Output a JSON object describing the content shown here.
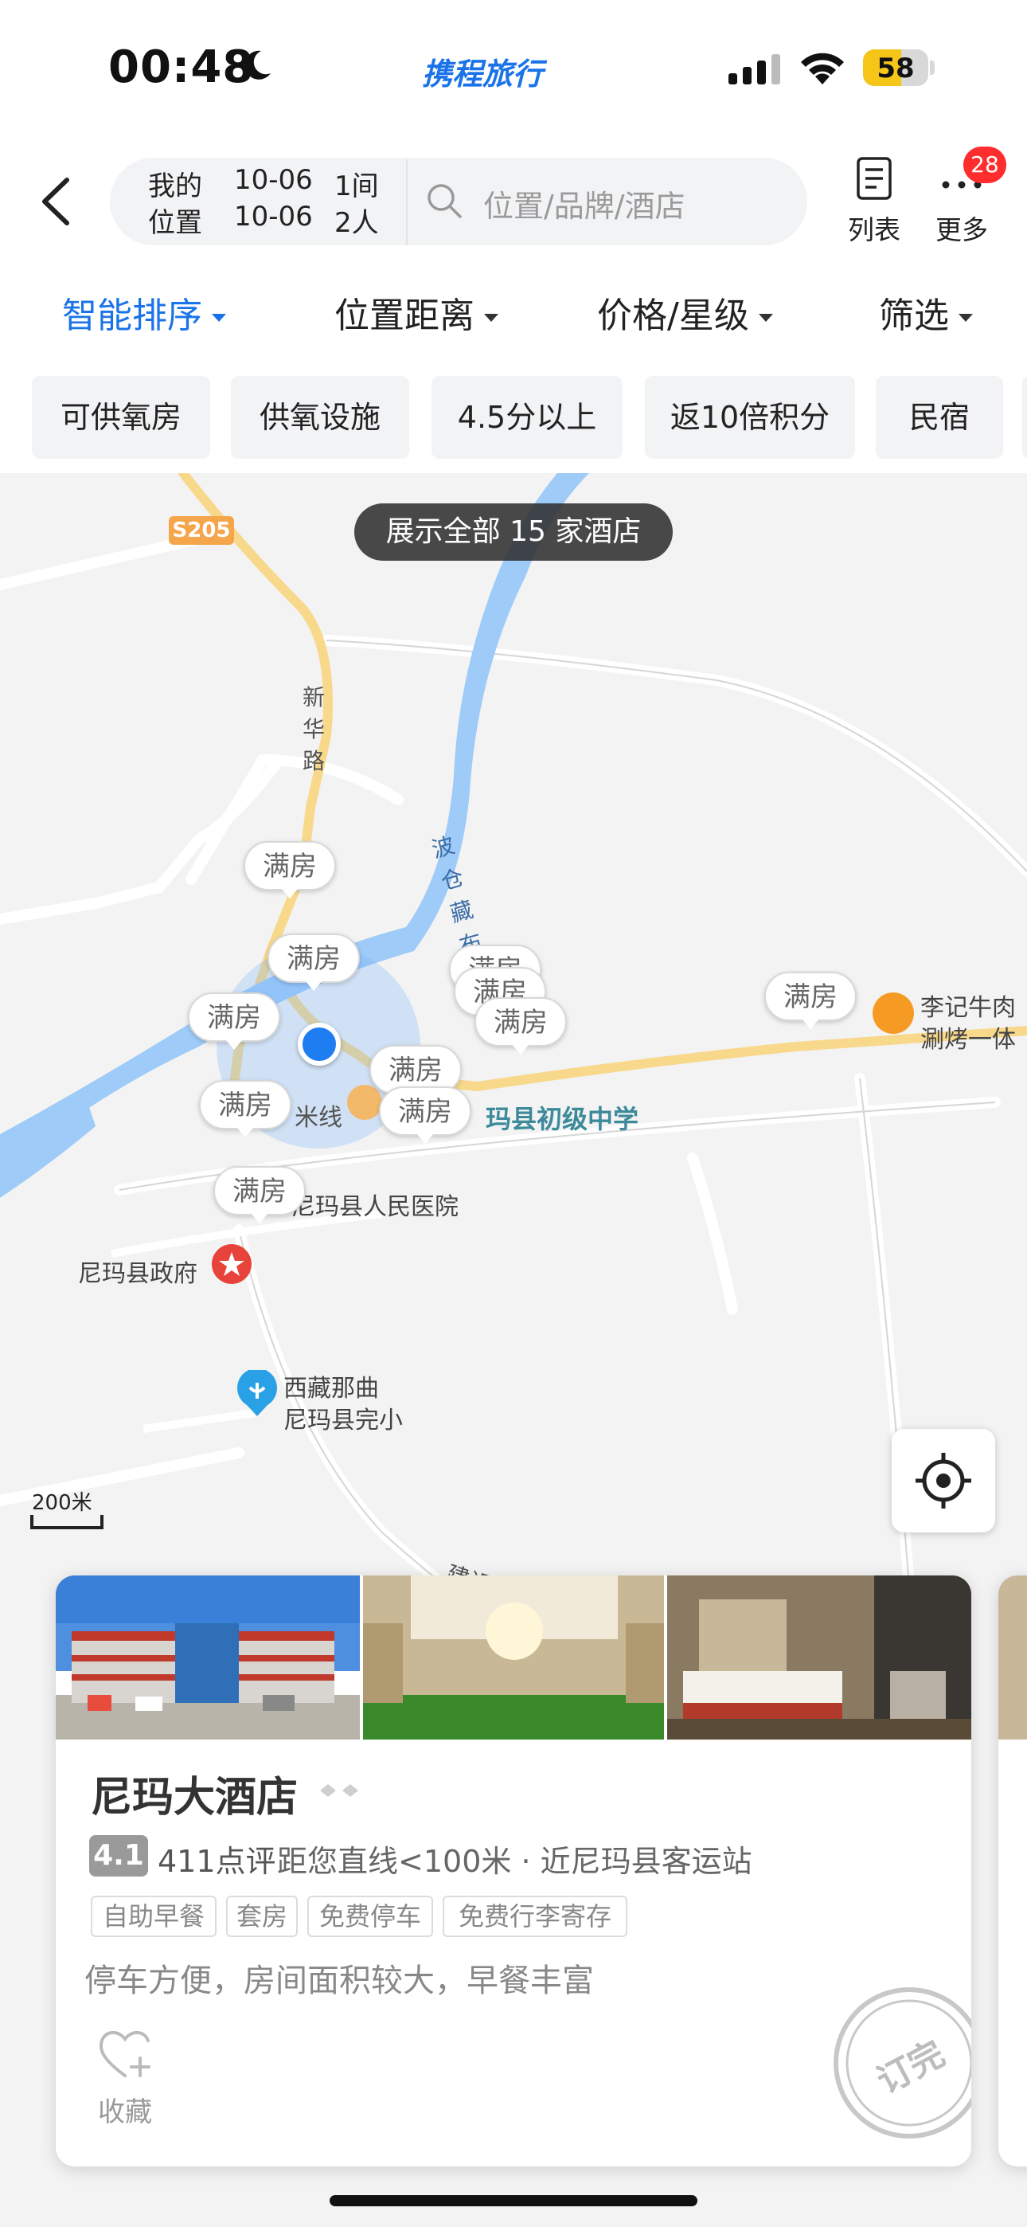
{
  "status_bar": {
    "time": "00:48",
    "app_logo_text": "携程旅行",
    "battery_level": "58",
    "battery_fraction": 0.58,
    "battery_color": "#f5c518"
  },
  "header": {
    "location_line1": "我的",
    "location_line2": "位置",
    "checkin": "10-06",
    "checkout": "10-06",
    "rooms": "1间",
    "guests": "2人",
    "search_placeholder": "位置/品牌/酒店",
    "list_label": "列表",
    "more_label": "更多",
    "more_badge_count": "28",
    "icons": [
      "back-arrow-icon",
      "search-icon",
      "list-icon",
      "more-dots-icon"
    ]
  },
  "sort_bar": {
    "items": [
      "智能排序",
      "位置距离",
      "价格/星级",
      "筛选"
    ],
    "active_index": 0,
    "accent_color": "#1a73e8"
  },
  "chips": [
    "可供氧房",
    "供氧设施",
    "4.5分以上",
    "返10倍积分",
    "民宿"
  ],
  "map": {
    "show_all_button": "展示全部 15 家酒店",
    "road_s205": "S205",
    "road_xinhua": "新华路",
    "river_name": "波仓藏布",
    "road_jianshe": "建设路",
    "poi_restaurant_line1": "李记牛肉",
    "poi_restaurant_line2": "涮烤一体",
    "poi_school": "玛县初级中学",
    "poi_hospital": "尼玛县人民医院",
    "poi_government": "尼玛县政府",
    "poi_xizang_line1": "西藏那曲",
    "poi_xizang_line2": "尼玛县完小",
    "poi_line_fragment": "米线",
    "full_marker_text": "满房",
    "scale_label": "200米"
  },
  "hotel_card": {
    "name": "尼玛大酒店",
    "score": "4.1",
    "reviews": "411点评",
    "distance": "距您直线<100米 · 近尼玛县客运站",
    "tags": [
      "自助早餐",
      "套房",
      "免费停车",
      "免费行李寄存"
    ],
    "highlight": "停车方便，房间面积较大，早餐丰富",
    "favorite_label": "收藏",
    "soldout_stamp": "订完"
  }
}
